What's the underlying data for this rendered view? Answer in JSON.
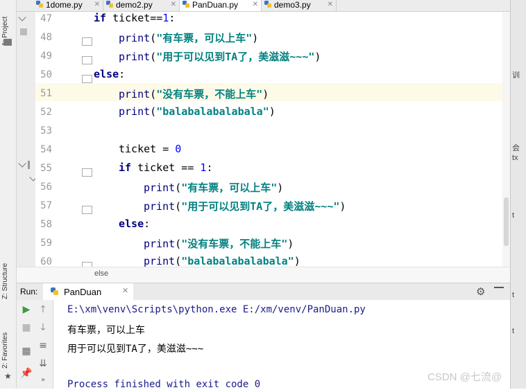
{
  "left_tools": {
    "project": "1: Project",
    "structure": "Z: Structure",
    "favorites": "2: Favorites"
  },
  "tabs": [
    {
      "label": "1dome.py",
      "active": false
    },
    {
      "label": "demo2.py",
      "active": false
    },
    {
      "label": "PanDuan.py",
      "active": true
    },
    {
      "label": "demo3.py",
      "active": false
    }
  ],
  "editor": {
    "lines": [
      {
        "no": "47",
        "code": [
          [
            "kw",
            "if "
          ],
          [
            "plain",
            "ticket=="
          ],
          [
            "num",
            "1"
          ],
          [
            "plain",
            ":"
          ]
        ],
        "indent": 0
      },
      {
        "no": "48",
        "code": [
          [
            "fn",
            "print"
          ],
          [
            "plain",
            "("
          ],
          [
            "str",
            "\"有车票，可以上车\""
          ],
          [
            "plain",
            ")"
          ]
        ],
        "indent": 1
      },
      {
        "no": "49",
        "code": [
          [
            "fn",
            "print"
          ],
          [
            "plain",
            "("
          ],
          [
            "str",
            "\"用于可以见到TA了，美滋滋~~~\""
          ],
          [
            "plain",
            ")"
          ]
        ],
        "indent": 1
      },
      {
        "no": "50",
        "code": [
          [
            "kw",
            "else"
          ],
          [
            "plain",
            ":"
          ]
        ],
        "indent": 0
      },
      {
        "no": "51",
        "code": [
          [
            "fn",
            "print"
          ],
          [
            "plain",
            "("
          ],
          [
            "str",
            "\"没有车票，不能上车\""
          ],
          [
            "plain",
            ")"
          ]
        ],
        "indent": 1
      },
      {
        "no": "52",
        "code": [
          [
            "fn",
            "print"
          ],
          [
            "plain",
            "("
          ],
          [
            "str",
            "\"balabalabalabala\""
          ],
          [
            "plain",
            ")"
          ]
        ],
        "indent": 1
      },
      {
        "no": "53",
        "code": [],
        "indent": 0
      },
      {
        "no": "54",
        "code": [
          [
            "plain",
            "ticket = "
          ],
          [
            "num",
            "0"
          ]
        ],
        "indent": 1
      },
      {
        "no": "55",
        "code": [
          [
            "kw",
            "if "
          ],
          [
            "plain",
            "ticket == "
          ],
          [
            "num",
            "1"
          ],
          [
            "plain",
            ":"
          ]
        ],
        "indent": 1
      },
      {
        "no": "56",
        "code": [
          [
            "fn",
            "print"
          ],
          [
            "plain",
            "("
          ],
          [
            "str",
            "\"有车票，可以上车\""
          ],
          [
            "plain",
            ")"
          ]
        ],
        "indent": 2
      },
      {
        "no": "57",
        "code": [
          [
            "fn",
            "print"
          ],
          [
            "plain",
            "("
          ],
          [
            "str",
            "\"用于可以见到TA了，美滋滋~~~\""
          ],
          [
            "plain",
            ")"
          ]
        ],
        "indent": 2
      },
      {
        "no": "58",
        "code": [
          [
            "kw",
            "else"
          ],
          [
            "plain",
            ":"
          ]
        ],
        "indent": 1
      },
      {
        "no": "59",
        "code": [
          [
            "fn",
            "print"
          ],
          [
            "plain",
            "("
          ],
          [
            "str",
            "\"没有车票，不能上车\""
          ],
          [
            "plain",
            ")"
          ]
        ],
        "indent": 2
      },
      {
        "no": "60",
        "code": [
          [
            "fn",
            "print"
          ],
          [
            "plain",
            "("
          ],
          [
            "str",
            "\"balabalabalabala\""
          ],
          [
            "plain",
            ")"
          ]
        ],
        "indent": 2
      }
    ],
    "breadcrumb": "else"
  },
  "run": {
    "label": "Run:",
    "tab": "PanDuan",
    "output": [
      {
        "text": "E:\\xm\\venv\\Scripts\\python.exe E:/xm/venv/PanDuan.py",
        "color": "#1a1a8c"
      },
      {
        "text": "有车票，可以上车",
        "color": "#000000"
      },
      {
        "text": "用于可以见到TA了，美滋滋~~~",
        "color": "#000000"
      },
      {
        "text": "",
        "color": "#000000"
      },
      {
        "text": "Process finished with exit code 0",
        "color": "#1a1a8c"
      }
    ]
  },
  "right_strip": [
    "训",
    "会",
    "tx",
    "t",
    "t",
    "t"
  ],
  "watermark": "CSDN @七流@",
  "colors": {
    "keyword": "#000080",
    "string": "#008080",
    "number": "#0000ff",
    "accent": "#3b73c8"
  }
}
